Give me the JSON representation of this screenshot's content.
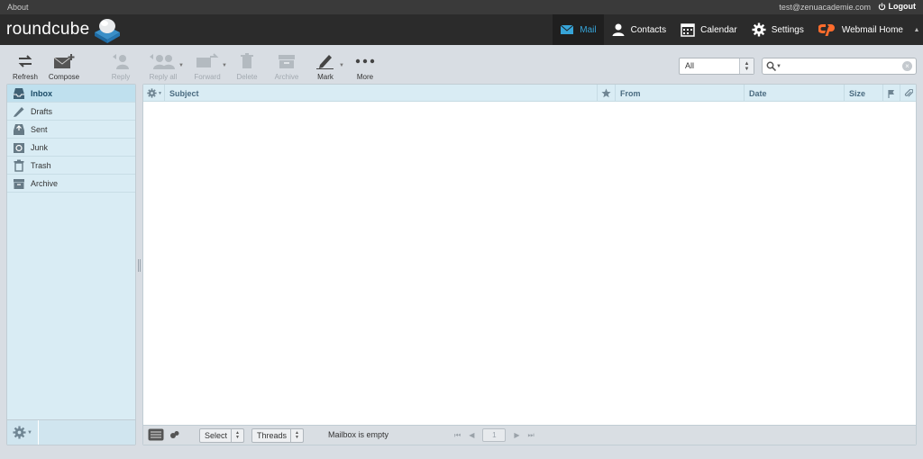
{
  "topbar": {
    "about": "About",
    "user": "test@zenuacademie.com",
    "logout": "Logout"
  },
  "logo": {
    "text": "roundcube"
  },
  "nav": {
    "mail": "Mail",
    "contacts": "Contacts",
    "calendar": "Calendar",
    "settings": "Settings",
    "webmail_home": "Webmail Home"
  },
  "toolbar": {
    "refresh": "Refresh",
    "compose": "Compose",
    "reply": "Reply",
    "reply_all": "Reply all",
    "forward": "Forward",
    "delete": "Delete",
    "archive": "Archive",
    "mark": "Mark",
    "more": "More"
  },
  "filter": {
    "value": "All"
  },
  "search": {
    "placeholder": "",
    "value": ""
  },
  "folders": [
    {
      "label": "Inbox",
      "icon": "inbox-icon",
      "active": true
    },
    {
      "label": "Drafts",
      "icon": "drafts-icon",
      "active": false
    },
    {
      "label": "Sent",
      "icon": "sent-icon",
      "active": false
    },
    {
      "label": "Junk",
      "icon": "junk-icon",
      "active": false
    },
    {
      "label": "Trash",
      "icon": "trash-icon",
      "active": false
    },
    {
      "label": "Archive",
      "icon": "archive-icon",
      "active": false
    }
  ],
  "list": {
    "columns": {
      "subject": "Subject",
      "from": "From",
      "date": "Date",
      "size": "Size"
    },
    "footer": {
      "select": "Select",
      "threads": "Threads",
      "status": "Mailbox is empty",
      "page": "1"
    }
  },
  "colors": {
    "accent": "#37a4d8",
    "header_bg": "#2b2b2b",
    "panel_bg": "#d9ecf4",
    "cpanel_orange": "#ff6c2c"
  }
}
